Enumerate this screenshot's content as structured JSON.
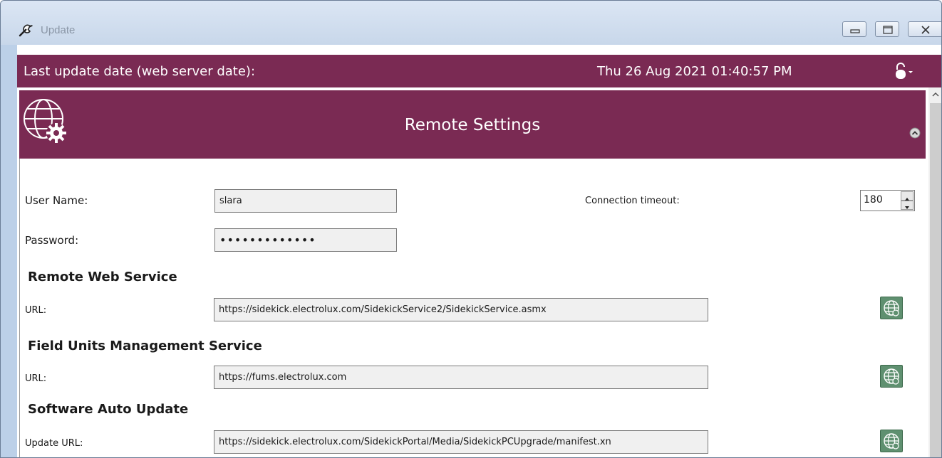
{
  "window": {
    "title": "Update",
    "icon": "wrench-icon"
  },
  "header": {
    "label": "Last update date (web server date):",
    "date": "Thu 26 Aug 2021 01:40:57 PM",
    "lock_icon": "lock-icon"
  },
  "panel": {
    "title": "Remote Settings",
    "icon": "globe-gear-icon"
  },
  "credentials": {
    "username_label": "User Name:",
    "username_value": "slara",
    "password_label": "Password:",
    "password_value": "•••••••••••••",
    "timeout_label": "Connection timeout:",
    "timeout_value": "180"
  },
  "sections": [
    {
      "title": "Remote Web Service",
      "url_label": "URL:",
      "url_value": "https://sidekick.electrolux.com/SidekickService2/SidekickService.asmx"
    },
    {
      "title": "Field Units Management Service",
      "url_label": "URL:",
      "url_value": "https://fums.electrolux.com"
    },
    {
      "title": "Software Auto Update",
      "url_label": "Update URL:",
      "url_value": "https://sidekick.electrolux.com/SidekickPortal/Media/SidekickPCUpgrade/manifest.xn"
    }
  ],
  "colors": {
    "header_bg": "#7a2a53",
    "globe_button": "#5f9070"
  }
}
